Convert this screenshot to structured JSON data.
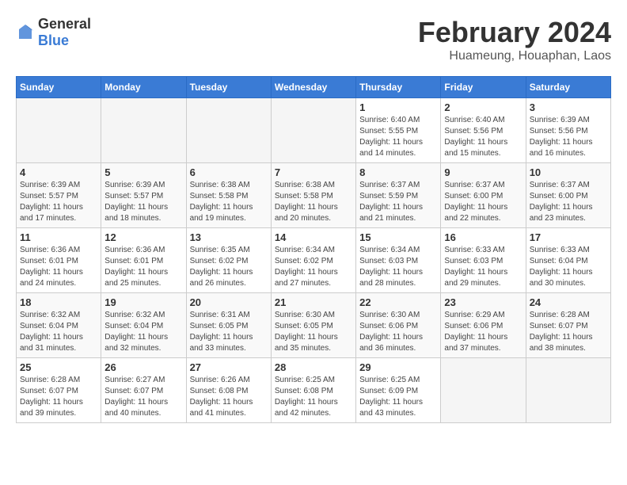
{
  "logo": {
    "general": "General",
    "blue": "Blue"
  },
  "title": "February 2024",
  "subtitle": "Huameung, Houaphan, Laos",
  "weekdays": [
    "Sunday",
    "Monday",
    "Tuesday",
    "Wednesday",
    "Thursday",
    "Friday",
    "Saturday"
  ],
  "weeks": [
    [
      {
        "day": "",
        "info": ""
      },
      {
        "day": "",
        "info": ""
      },
      {
        "day": "",
        "info": ""
      },
      {
        "day": "",
        "info": ""
      },
      {
        "day": "1",
        "info": "Sunrise: 6:40 AM\nSunset: 5:55 PM\nDaylight: 11 hours\nand 14 minutes."
      },
      {
        "day": "2",
        "info": "Sunrise: 6:40 AM\nSunset: 5:56 PM\nDaylight: 11 hours\nand 15 minutes."
      },
      {
        "day": "3",
        "info": "Sunrise: 6:39 AM\nSunset: 5:56 PM\nDaylight: 11 hours\nand 16 minutes."
      }
    ],
    [
      {
        "day": "4",
        "info": "Sunrise: 6:39 AM\nSunset: 5:57 PM\nDaylight: 11 hours\nand 17 minutes."
      },
      {
        "day": "5",
        "info": "Sunrise: 6:39 AM\nSunset: 5:57 PM\nDaylight: 11 hours\nand 18 minutes."
      },
      {
        "day": "6",
        "info": "Sunrise: 6:38 AM\nSunset: 5:58 PM\nDaylight: 11 hours\nand 19 minutes."
      },
      {
        "day": "7",
        "info": "Sunrise: 6:38 AM\nSunset: 5:58 PM\nDaylight: 11 hours\nand 20 minutes."
      },
      {
        "day": "8",
        "info": "Sunrise: 6:37 AM\nSunset: 5:59 PM\nDaylight: 11 hours\nand 21 minutes."
      },
      {
        "day": "9",
        "info": "Sunrise: 6:37 AM\nSunset: 6:00 PM\nDaylight: 11 hours\nand 22 minutes."
      },
      {
        "day": "10",
        "info": "Sunrise: 6:37 AM\nSunset: 6:00 PM\nDaylight: 11 hours\nand 23 minutes."
      }
    ],
    [
      {
        "day": "11",
        "info": "Sunrise: 6:36 AM\nSunset: 6:01 PM\nDaylight: 11 hours\nand 24 minutes."
      },
      {
        "day": "12",
        "info": "Sunrise: 6:36 AM\nSunset: 6:01 PM\nDaylight: 11 hours\nand 25 minutes."
      },
      {
        "day": "13",
        "info": "Sunrise: 6:35 AM\nSunset: 6:02 PM\nDaylight: 11 hours\nand 26 minutes."
      },
      {
        "day": "14",
        "info": "Sunrise: 6:34 AM\nSunset: 6:02 PM\nDaylight: 11 hours\nand 27 minutes."
      },
      {
        "day": "15",
        "info": "Sunrise: 6:34 AM\nSunset: 6:03 PM\nDaylight: 11 hours\nand 28 minutes."
      },
      {
        "day": "16",
        "info": "Sunrise: 6:33 AM\nSunset: 6:03 PM\nDaylight: 11 hours\nand 29 minutes."
      },
      {
        "day": "17",
        "info": "Sunrise: 6:33 AM\nSunset: 6:04 PM\nDaylight: 11 hours\nand 30 minutes."
      }
    ],
    [
      {
        "day": "18",
        "info": "Sunrise: 6:32 AM\nSunset: 6:04 PM\nDaylight: 11 hours\nand 31 minutes."
      },
      {
        "day": "19",
        "info": "Sunrise: 6:32 AM\nSunset: 6:04 PM\nDaylight: 11 hours\nand 32 minutes."
      },
      {
        "day": "20",
        "info": "Sunrise: 6:31 AM\nSunset: 6:05 PM\nDaylight: 11 hours\nand 33 minutes."
      },
      {
        "day": "21",
        "info": "Sunrise: 6:30 AM\nSunset: 6:05 PM\nDaylight: 11 hours\nand 35 minutes."
      },
      {
        "day": "22",
        "info": "Sunrise: 6:30 AM\nSunset: 6:06 PM\nDaylight: 11 hours\nand 36 minutes."
      },
      {
        "day": "23",
        "info": "Sunrise: 6:29 AM\nSunset: 6:06 PM\nDaylight: 11 hours\nand 37 minutes."
      },
      {
        "day": "24",
        "info": "Sunrise: 6:28 AM\nSunset: 6:07 PM\nDaylight: 11 hours\nand 38 minutes."
      }
    ],
    [
      {
        "day": "25",
        "info": "Sunrise: 6:28 AM\nSunset: 6:07 PM\nDaylight: 11 hours\nand 39 minutes."
      },
      {
        "day": "26",
        "info": "Sunrise: 6:27 AM\nSunset: 6:07 PM\nDaylight: 11 hours\nand 40 minutes."
      },
      {
        "day": "27",
        "info": "Sunrise: 6:26 AM\nSunset: 6:08 PM\nDaylight: 11 hours\nand 41 minutes."
      },
      {
        "day": "28",
        "info": "Sunrise: 6:25 AM\nSunset: 6:08 PM\nDaylight: 11 hours\nand 42 minutes."
      },
      {
        "day": "29",
        "info": "Sunrise: 6:25 AM\nSunset: 6:09 PM\nDaylight: 11 hours\nand 43 minutes."
      },
      {
        "day": "",
        "info": ""
      },
      {
        "day": "",
        "info": ""
      }
    ]
  ]
}
